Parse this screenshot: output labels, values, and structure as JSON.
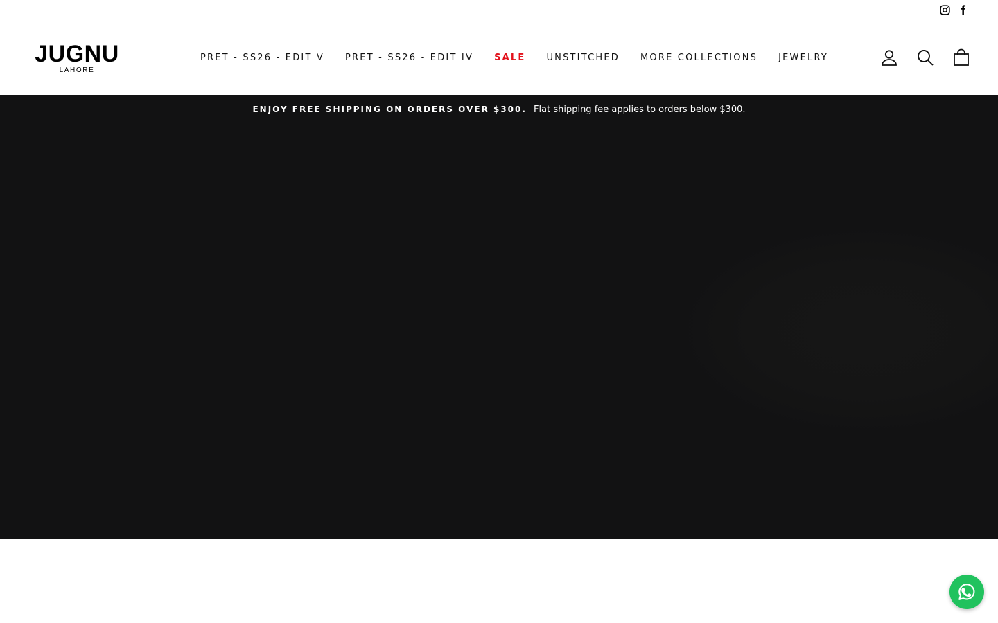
{
  "topbar": {
    "social": [
      {
        "name": "instagram-icon",
        "label": "Instagram"
      },
      {
        "name": "facebook-icon",
        "label": "Facebook"
      }
    ]
  },
  "header": {
    "logo": {
      "main": "JUGNU",
      "sub": "LAHORE"
    },
    "nav": [
      {
        "label": "PRET - SS26 - EDIT V"
      },
      {
        "label": "PRET - SS26 - EDIT IV"
      },
      {
        "label": "SALE",
        "color": "#e3101a"
      },
      {
        "label": "UNSTITCHED"
      },
      {
        "label": "MORE COLLECTIONS"
      },
      {
        "label": "JEWELRY"
      }
    ],
    "icons": [
      "user-icon",
      "search-icon",
      "cart-icon"
    ]
  },
  "hero": {
    "announcement_bold": "ENJOY FREE SHIPPING ON ORDERS OVER $300.",
    "announcement_text": "Flat shipping fee applies to orders below $300.",
    "background": "#121213"
  },
  "floating": {
    "whatsapp": {
      "icon": "whatsapp-icon",
      "color": "#21c25e"
    }
  }
}
